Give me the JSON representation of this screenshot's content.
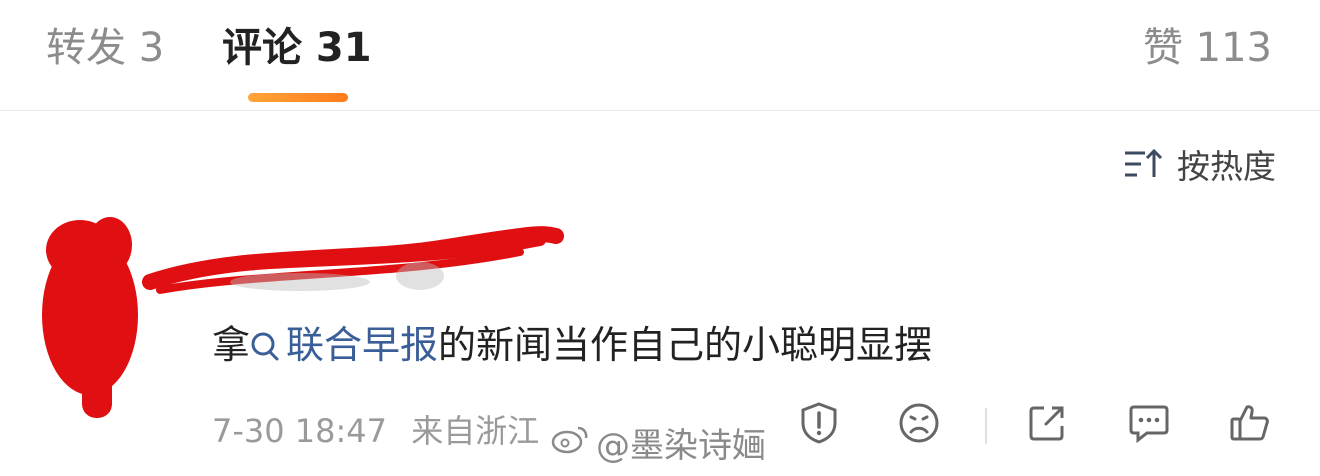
{
  "tabs": {
    "repost": "转发 3",
    "comments": "评论 31",
    "likes": "赞 113"
  },
  "sort": {
    "label": "按热度"
  },
  "comment": {
    "prefix": "拿",
    "topic": "联合早报",
    "suffix": "的新闻当作自己的小聪明显摆",
    "time": "7-30 18:47",
    "location": "来自浙江"
  },
  "watermark": "@墨染诗婳",
  "colors": {
    "accent": "#ff8c28",
    "topic_link": "#3a5e97",
    "redaction": "#e00f12"
  }
}
